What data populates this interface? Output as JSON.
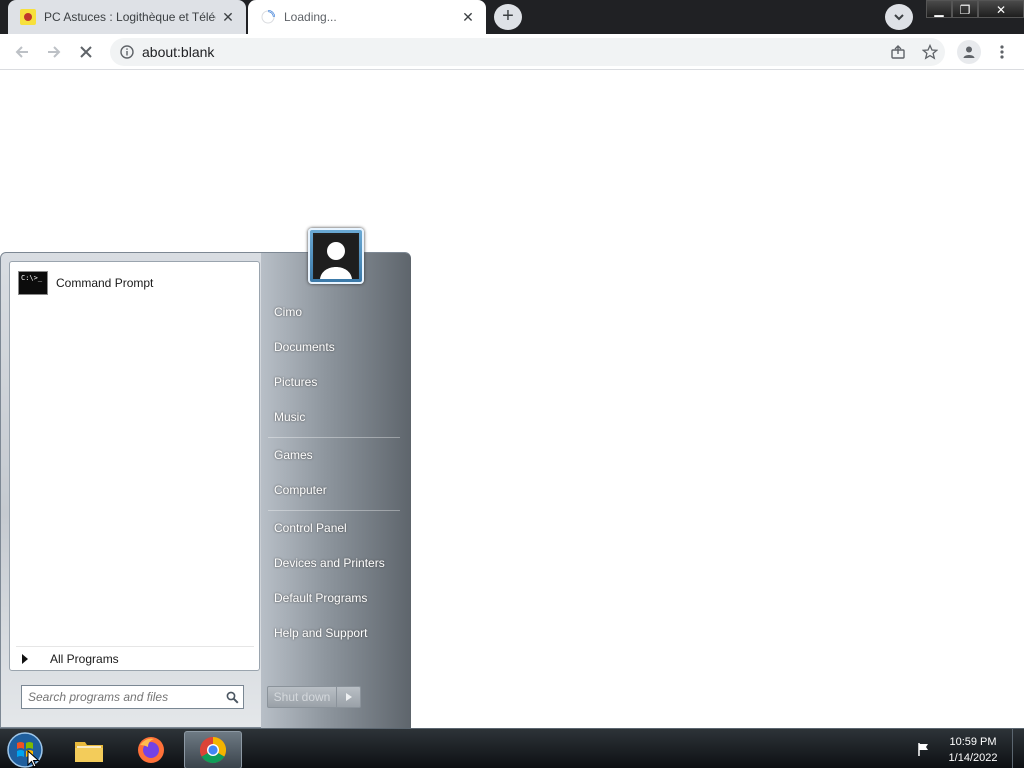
{
  "browser": {
    "tabs": [
      {
        "title": "PC Astuces : Logithèque et Téléc",
        "state": "inactive"
      },
      {
        "title": "Loading...",
        "state": "active"
      }
    ],
    "new_tab_label": "+",
    "address": "about:blank",
    "accent_color": "#202124"
  },
  "start_menu": {
    "pinned": [
      {
        "label": "Command Prompt",
        "icon": "command-prompt-icon",
        "icon_text": "C:\\>_"
      }
    ],
    "all_programs_label": "All Programs",
    "search_placeholder": "Search programs and files",
    "right_links": [
      {
        "label": "Cimo"
      },
      {
        "label": "Documents"
      },
      {
        "label": "Pictures"
      },
      {
        "label": "Music"
      },
      {
        "label": "Games"
      },
      {
        "label": "Computer"
      },
      {
        "label": "Control Panel"
      },
      {
        "label": "Devices and Printers"
      },
      {
        "label": "Default Programs"
      },
      {
        "label": "Help and Support"
      }
    ],
    "shutdown_label": "Shut down"
  },
  "taskbar": {
    "apps": [
      {
        "name": "windows-explorer",
        "icon": "folder-icon"
      },
      {
        "name": "firefox",
        "icon": "firefox-icon"
      },
      {
        "name": "chrome",
        "icon": "chrome-icon",
        "active": true
      }
    ],
    "clock_time": "10:59 PM",
    "clock_date": "1/14/2022"
  }
}
